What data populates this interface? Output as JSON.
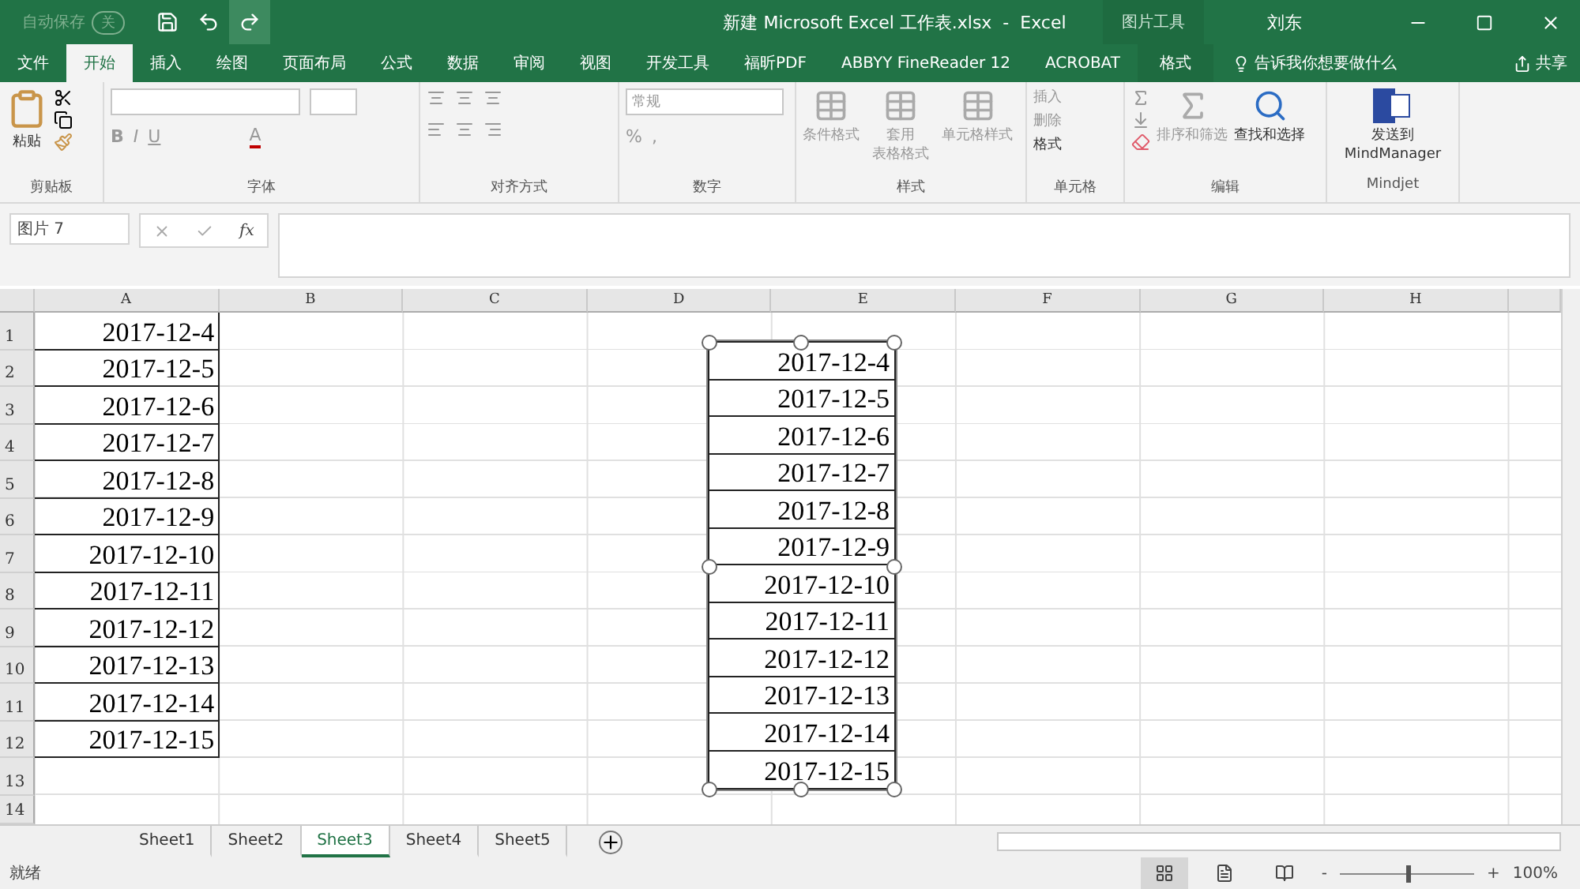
{
  "title_bar": {
    "autosave_label": "自动保存",
    "autosave_state": "关",
    "autosave_on": false,
    "document_title": "新建 Microsoft Excel 工作表.xlsx  -  Excel",
    "context_tab": "图片工具",
    "user": "刘东"
  },
  "ribbon_tabs": [
    {
      "label": "文件",
      "selected": false
    },
    {
      "label": "开始",
      "selected": true
    },
    {
      "label": "插入",
      "selected": false
    },
    {
      "label": "绘图",
      "selected": false
    },
    {
      "label": "页面布局",
      "selected": false
    },
    {
      "label": "公式",
      "selected": false
    },
    {
      "label": "数据",
      "selected": false
    },
    {
      "label": "审阅",
      "selected": false
    },
    {
      "label": "视图",
      "selected": false
    },
    {
      "label": "开发工具",
      "selected": false
    },
    {
      "label": "福昕PDF",
      "selected": false
    },
    {
      "label": "ABBYY FineReader 12",
      "selected": false
    },
    {
      "label": "ACROBAT",
      "selected": false
    },
    {
      "label": "格式",
      "selected": false,
      "kind": "context"
    }
  ],
  "tell_me": "告诉我你想要做什么",
  "share": "共享",
  "ribbon": {
    "paste": "粘贴",
    "bold": "B",
    "italic": "I",
    "underline": "U",
    "font_color": "A",
    "number_format": "常规",
    "percent": "%",
    "comma": ",",
    "conditional_format": "条件格式",
    "table_format": [
      "套用",
      "表格格式"
    ],
    "cell_styles": "单元格样式",
    "insert": "插入",
    "delete": "删除",
    "format": "格式",
    "sort_filter": "排序和筛选",
    "find_select": "查找和选择",
    "send_to": [
      "发送到",
      "MindManager"
    ],
    "groups": [
      "剪贴板",
      "字体",
      "对齐方式",
      "数字",
      "样式",
      "单元格",
      "编辑",
      "Mindjet"
    ]
  },
  "formula_bar": {
    "name_box": "图片 7",
    "fx": "fx"
  },
  "columns": [
    "A",
    "B",
    "C",
    "D",
    "E",
    "F",
    "G",
    "H"
  ],
  "rows": [
    "1",
    "2",
    "3",
    "4",
    "5",
    "6",
    "7",
    "8",
    "9",
    "10",
    "11",
    "12",
    "13",
    "14"
  ],
  "column_a": [
    "2017-12-4",
    "2017-12-5",
    "2017-12-6",
    "2017-12-7",
    "2017-12-8",
    "2017-12-9",
    "2017-12-10",
    "2017-12-11",
    "2017-12-12",
    "2017-12-13",
    "2017-12-14",
    "2017-12-15"
  ],
  "picture_7": {
    "selected": true,
    "cells": [
      "2017-12-4",
      "2017-12-5",
      "2017-12-6",
      "2017-12-7",
      "2017-12-8",
      "2017-12-9",
      "2017-12-10",
      "2017-12-11",
      "2017-12-12",
      "2017-12-13",
      "2017-12-14",
      "2017-12-15"
    ]
  },
  "sheets": [
    {
      "label": "Sheet1",
      "selected": false
    },
    {
      "label": "Sheet2",
      "selected": false
    },
    {
      "label": "Sheet3",
      "selected": true
    },
    {
      "label": "Sheet4",
      "selected": false
    },
    {
      "label": "Sheet5",
      "selected": false
    }
  ],
  "status_bar": {
    "status": "就绪",
    "views": [
      {
        "kind": "normal",
        "selected": true
      },
      {
        "kind": "layout",
        "selected": false
      },
      {
        "kind": "pagebreak",
        "selected": false
      }
    ],
    "zoom_minus": "-",
    "zoom_plus": "+",
    "zoom": {
      "level": 0.5
    },
    "zoom_text": "100%"
  }
}
